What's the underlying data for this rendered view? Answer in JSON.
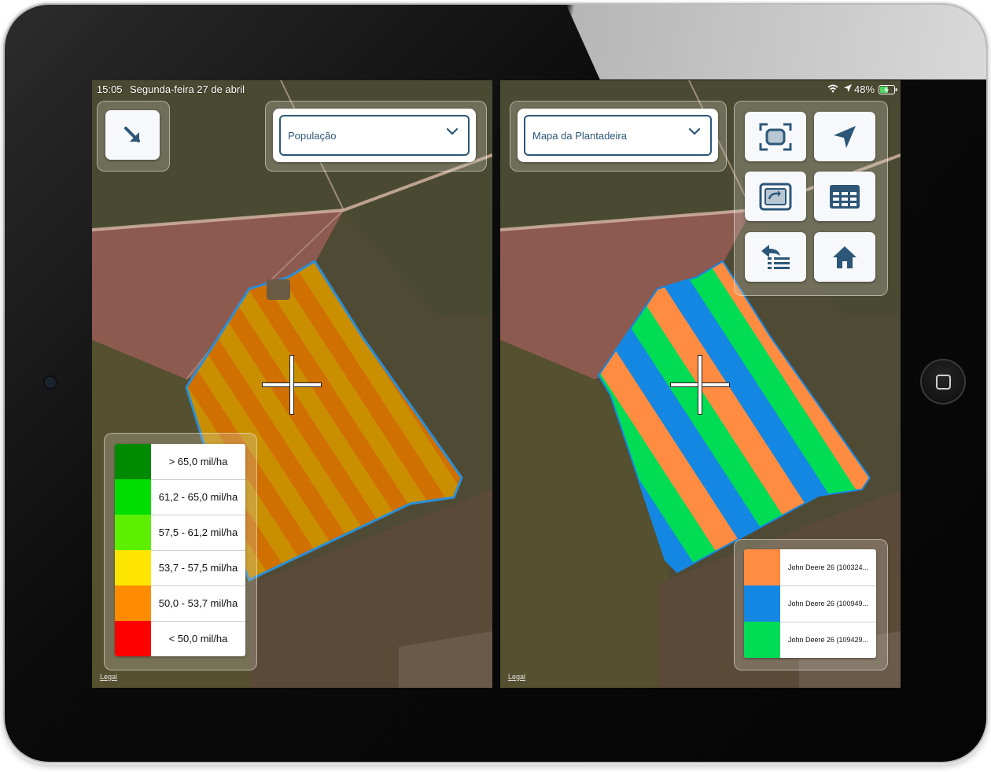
{
  "status": {
    "time": "15:05",
    "date": "Segunda-feira 27 de abril",
    "battery": "48%",
    "icons": [
      "wifi-icon",
      "location-arrow-icon",
      "battery-charging-icon"
    ]
  },
  "left_panel": {
    "corner_button_icon": "arrow-down-right-icon",
    "layer_select": {
      "value": "População"
    },
    "legend": {
      "items": [
        {
          "label": "> 65,0 mil/ha",
          "color": "#008a00"
        },
        {
          "label": "61,2 - 65,0 mil/ha",
          "color": "#00dd00"
        },
        {
          "label": "57,5 - 61,2 mil/ha",
          "color": "#5cf000"
        },
        {
          "label": "53,7 - 57,5 mil/ha",
          "color": "#ffe600"
        },
        {
          "label": "50,0 - 53,7 mil/ha",
          "color": "#ff8c00"
        },
        {
          "label": "< 50,0 mil/ha",
          "color": "#ff0000"
        }
      ]
    },
    "legal": "Legal"
  },
  "right_panel": {
    "layer_select": {
      "value": "Mapa da Plantadeira"
    },
    "tools": [
      {
        "name": "fit-extent-button",
        "icon": "frame-focus-icon"
      },
      {
        "name": "locate-button",
        "icon": "location-arrow-icon"
      },
      {
        "name": "switch-map-button",
        "icon": "switch-screen-icon"
      },
      {
        "name": "table-button",
        "icon": "table-icon"
      },
      {
        "name": "list-button",
        "icon": "list-back-icon"
      },
      {
        "name": "home-button",
        "icon": "home-icon"
      }
    ],
    "legend": {
      "items": [
        {
          "label": "John Deere 26 (100324...",
          "color": "#ff8c40"
        },
        {
          "label": "John Deere 26 (100949...",
          "color": "#1487e3"
        },
        {
          "label": "John Deere 26 (109429...",
          "color": "#00dd55"
        }
      ]
    },
    "legal": "Legal"
  },
  "colors": {
    "accent": "#2c5778",
    "button_bg": "#f6f8fb"
  }
}
